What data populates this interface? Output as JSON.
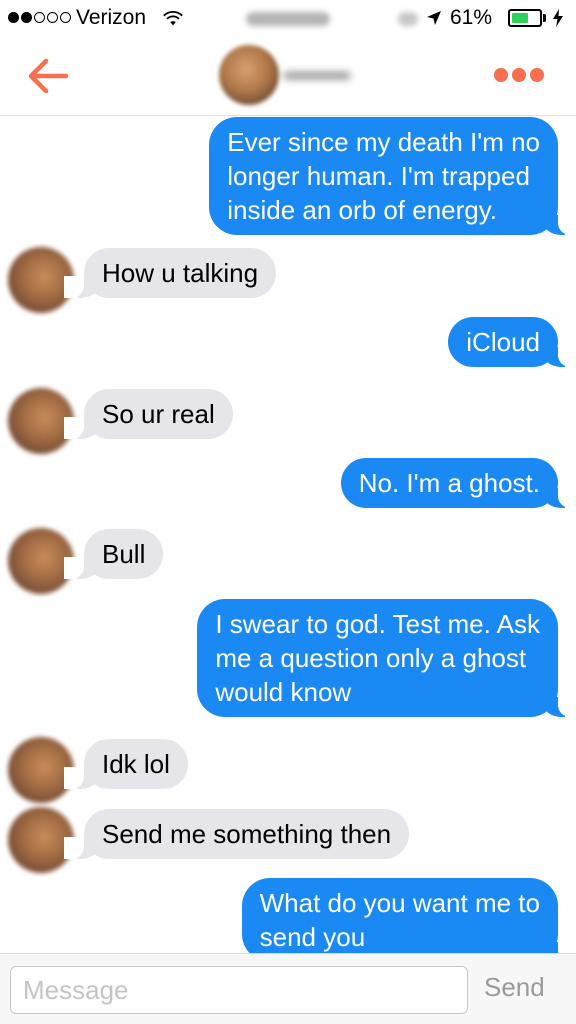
{
  "status_bar": {
    "carrier": "Verizon",
    "battery_percent": "61%",
    "battery_level": 0.61,
    "signal_bars_filled": 2,
    "signal_bars_total": 5
  },
  "header": {
    "back_icon": "back-arrow-icon",
    "more_icon": "more-dots-icon",
    "accent_color": "#f96e4f"
  },
  "messages": [
    {
      "direction": "out",
      "text": [
        "Ever since my death I'm no",
        "longer human. I'm trapped",
        "inside an orb of energy."
      ]
    },
    {
      "direction": "in",
      "text": [
        "How u talking"
      ]
    },
    {
      "direction": "out",
      "text": [
        "iCloud"
      ]
    },
    {
      "direction": "in",
      "text": [
        "So ur real"
      ]
    },
    {
      "direction": "out",
      "text": [
        "No. I'm a ghost."
      ]
    },
    {
      "direction": "in",
      "text": [
        "Bull"
      ]
    },
    {
      "direction": "out",
      "text": [
        "I swear to god. Test me. Ask",
        "me a question only a ghost",
        "would know"
      ]
    },
    {
      "direction": "in",
      "text": [
        "Idk lol"
      ]
    },
    {
      "direction": "in",
      "text": [
        "Send me something then"
      ]
    },
    {
      "direction": "out",
      "text": [
        "What do you want me to",
        "send you"
      ]
    }
  ],
  "colors": {
    "outgoing_bubble": "#1a89f3",
    "incoming_bubble": "#e5e5ea"
  },
  "composer": {
    "placeholder": "Message",
    "value": "",
    "send_label": "Send"
  }
}
